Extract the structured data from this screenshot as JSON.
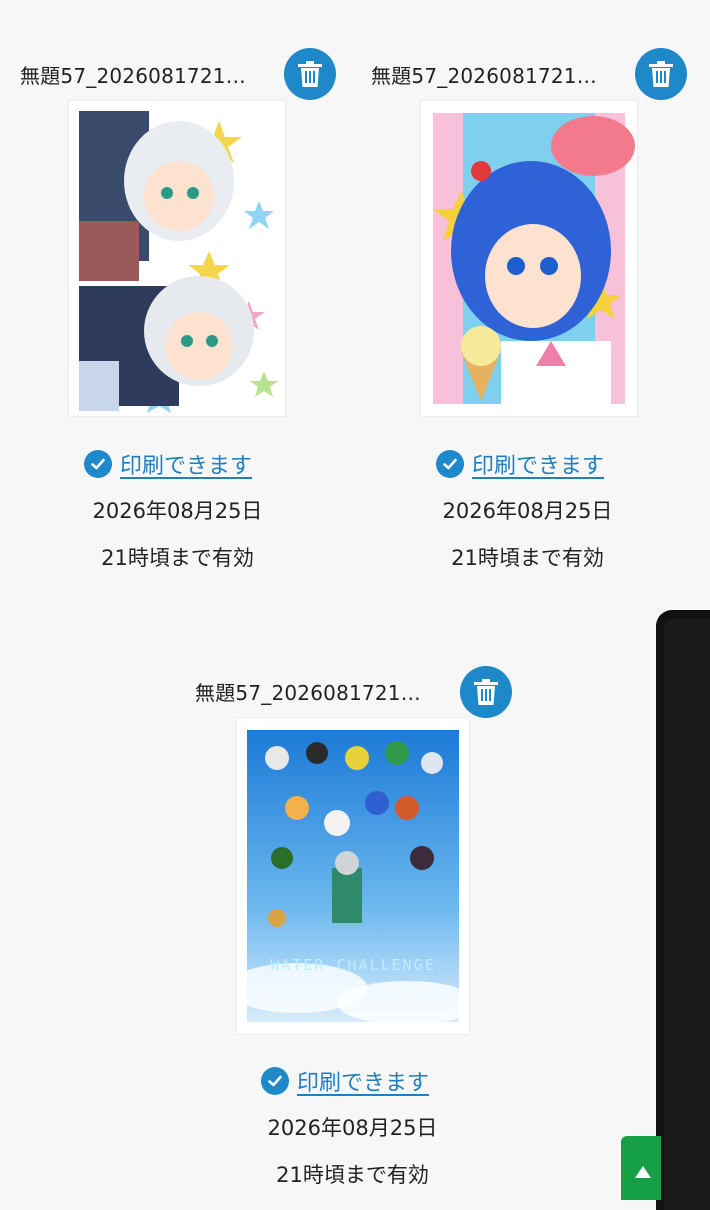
{
  "files": [
    {
      "name": "無題57_2026081721…",
      "status": "印刷できます",
      "date": "2026年08月25日",
      "valid_until": "21時頃まで有効",
      "thumbnail": "illustration-two-characters-stars"
    },
    {
      "name": "無題57_2026081721…",
      "status": "印刷できます",
      "date": "2026年08月25日",
      "valid_until": "21時頃まで有効",
      "thumbnail": "illustration-blue-hair-ice-cream"
    },
    {
      "name": "無題57_2026081721…",
      "status": "印刷できます",
      "date": "2026年08月25日",
      "valid_until": "21時頃まで有効",
      "thumbnail": "illustration-water-challenge-poster",
      "thumbnail_text": "WATER CHALLENGE"
    }
  ],
  "icons": {
    "delete": "trash-icon",
    "status": "check-circle-icon"
  },
  "colors": {
    "accent": "#1f88c8",
    "link": "#1f7fc0",
    "background": "#f7f7f7",
    "green_button": "#15a046"
  }
}
